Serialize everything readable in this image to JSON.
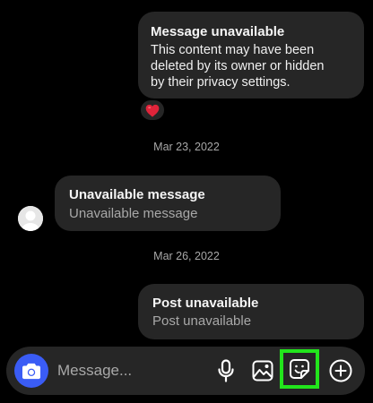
{
  "messages": [
    {
      "title": "Message unavailable",
      "body": "This content may have been\ndeleted by its owner or hidden\nby their privacy settings.",
      "reaction": "❤️",
      "reaction_icon": "heart-emoji-icon"
    },
    {
      "timestamp": "Mar 23, 2022",
      "title": "Unavailable message",
      "subtitle": "Unavailable message",
      "avatar_icon": "default-avatar-icon"
    },
    {
      "timestamp": "Mar 26, 2022",
      "title": "Post unavailable",
      "subtitle": "Post unavailable"
    }
  ],
  "composer": {
    "placeholder": "Message...",
    "camera_icon": "camera-icon",
    "mic_icon": "microphone-icon",
    "gallery_icon": "gallery-icon",
    "sticker_icon": "sticker-icon",
    "plus_icon": "plus-circle-icon",
    "camera_color": "#3a5cf5",
    "highlight_color": "#22e51c"
  },
  "colors": {
    "background": "#000000",
    "bubble": "#262626",
    "muted_text": "#a8a8a8"
  }
}
